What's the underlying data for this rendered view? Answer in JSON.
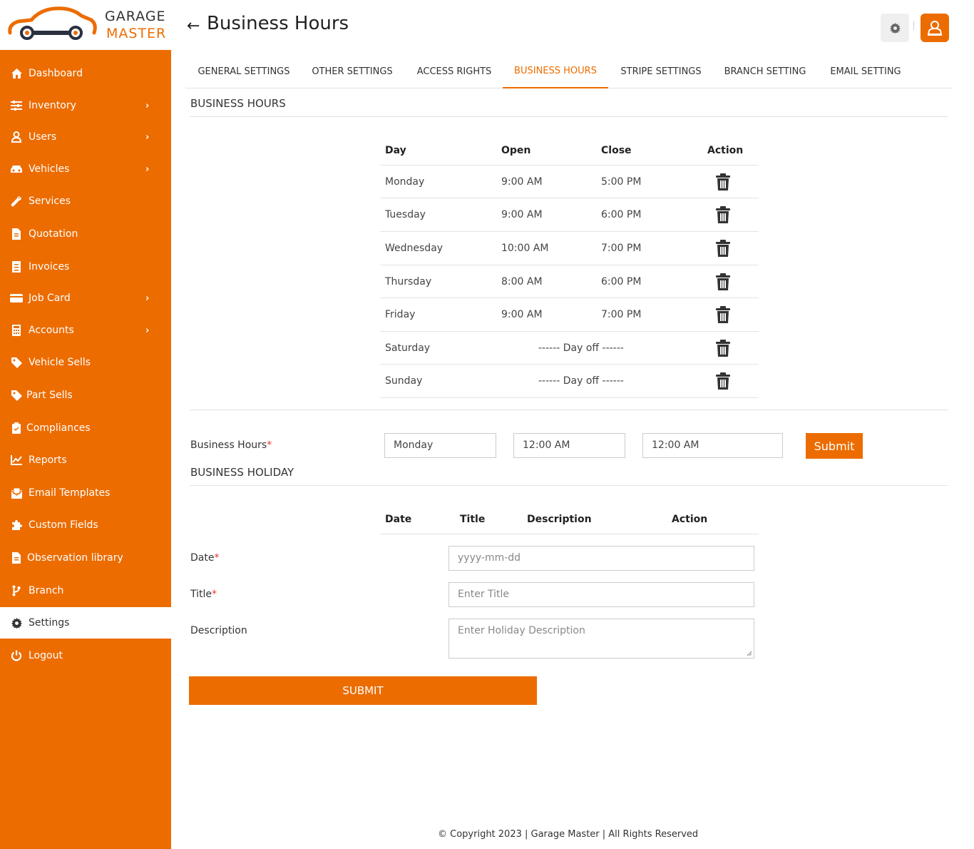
{
  "brand": {
    "line1": "GARAGE",
    "line2": "MASTER"
  },
  "colors": {
    "accent": "#ec6c00",
    "danger": "#e53935"
  },
  "sidebar": {
    "items": [
      {
        "label": "Dashboard",
        "icon": "home-icon",
        "has_submenu": false
      },
      {
        "label": "Inventory",
        "icon": "sliders-icon",
        "has_submenu": true
      },
      {
        "label": "Users",
        "icon": "user-icon",
        "has_submenu": true
      },
      {
        "label": "Vehicles",
        "icon": "car-icon",
        "has_submenu": true
      },
      {
        "label": "Services",
        "icon": "wrench-icon",
        "has_submenu": false
      },
      {
        "label": "Quotation",
        "icon": "file-icon",
        "has_submenu": false
      },
      {
        "label": "Invoices",
        "icon": "receipt-icon",
        "has_submenu": false
      },
      {
        "label": "Job Card",
        "icon": "card-icon",
        "has_submenu": true
      },
      {
        "label": "Accounts",
        "icon": "calculator-icon",
        "has_submenu": true
      },
      {
        "label": "Vehicle Sells",
        "icon": "tag-icon",
        "has_submenu": false
      },
      {
        "label": "Part Sells",
        "icon": "tag-icon",
        "has_submenu": false
      },
      {
        "label": "Compliances",
        "icon": "clipboard-icon",
        "has_submenu": false
      },
      {
        "label": "Reports",
        "icon": "chart-line-icon",
        "has_submenu": false
      },
      {
        "label": "Email Templates",
        "icon": "envelope-icon",
        "has_submenu": false
      },
      {
        "label": "Custom Fields",
        "icon": "puzzle-icon",
        "has_submenu": false
      },
      {
        "label": "Observation library",
        "icon": "file-icon",
        "has_submenu": false
      },
      {
        "label": "Branch",
        "icon": "branch-icon",
        "has_submenu": false
      },
      {
        "label": "Settings",
        "icon": "gear-icon",
        "has_submenu": false,
        "active": true
      },
      {
        "label": "Logout",
        "icon": "power-icon",
        "has_submenu": false
      }
    ]
  },
  "header": {
    "title": "Business Hours"
  },
  "tabs": [
    {
      "label": "GENERAL SETTINGS"
    },
    {
      "label": "OTHER SETTINGS"
    },
    {
      "label": "ACCESS RIGHTS"
    },
    {
      "label": "BUSINESS HOURS",
      "active": true
    },
    {
      "label": "STRIPE SETTINGS"
    },
    {
      "label": "BRANCH SETTING"
    },
    {
      "label": "EMAIL SETTING"
    }
  ],
  "hours": {
    "section_title": "BUSINESS HOURS",
    "columns": {
      "day": "Day",
      "open": "Open",
      "close": "Close",
      "action": "Action"
    },
    "rows": [
      {
        "day": "Monday",
        "open": "9:00 AM",
        "close": "5:00 PM"
      },
      {
        "day": "Tuesday",
        "open": "9:00 AM",
        "close": "6:00 PM"
      },
      {
        "day": "Wednesday",
        "open": "10:00 AM",
        "close": "7:00 PM"
      },
      {
        "day": "Thursday",
        "open": "8:00 AM",
        "close": "6:00 PM"
      },
      {
        "day": "Friday",
        "open": "9:00 AM",
        "close": "7:00 PM"
      },
      {
        "day": "Saturday",
        "off": "------ Day off ------"
      },
      {
        "day": "Sunday",
        "off": "------ Day off ------"
      }
    ]
  },
  "hours_form": {
    "label": "Business Hours",
    "required_mark": "*",
    "day_value": "Monday",
    "open_value": "12:00 AM",
    "close_value": "12:00 AM",
    "submit_label": "Submit"
  },
  "holiday": {
    "section_title": "BUSINESS HOLIDAY",
    "columns": {
      "date": "Date",
      "title": "Title",
      "description": "Description",
      "action": "Action"
    },
    "form": {
      "date_label": "Date",
      "date_placeholder": "yyyy-mm-dd",
      "title_label": "Title",
      "title_placeholder": "Enter Title",
      "description_label": "Description",
      "description_placeholder": "Enter Holiday Description",
      "required_mark": "*",
      "submit_label": "SUBMIT"
    }
  },
  "footer": {
    "text": "© Copyright 2023 | Garage Master | All Rights Reserved"
  }
}
